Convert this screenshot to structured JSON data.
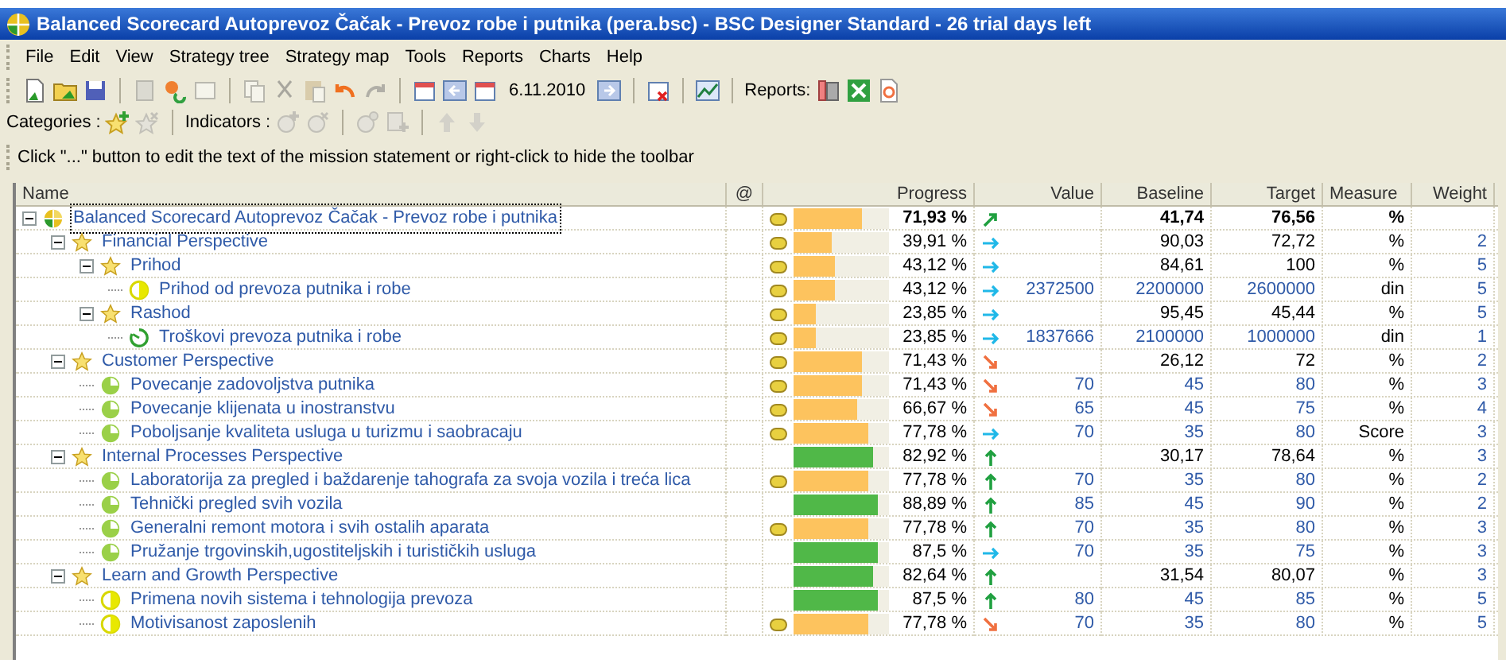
{
  "window": {
    "title": "Balanced Scorecard Autoprevoz Čačak - Prevoz robe i putnika (pera.bsc) - BSC Designer Standard - 26 trial days left"
  },
  "menu": [
    "File",
    "Edit",
    "View",
    "Strategy tree",
    "Strategy map",
    "Tools",
    "Reports",
    "Charts",
    "Help"
  ],
  "toolbar": {
    "date": "6.11.2010",
    "reports_label": "Reports:"
  },
  "category_toolbar": {
    "categories_label": "Categories :",
    "indicators_label": "Indicators :"
  },
  "mission_bar": {
    "text": "Click \"...\" button to edit the text of the mission statement or right-click to hide the toolbar"
  },
  "table": {
    "columns": [
      "Name",
      "@",
      "Progress",
      "Value",
      "Baseline",
      "Target",
      "Measure",
      "Weight"
    ],
    "rows": [
      {
        "name": "Balanced Scorecard Autoprevoz Čačak - Prevoz robe i putnika",
        "kind": "root",
        "expanded": true,
        "selected": true,
        "alert": true,
        "level": 0.7193,
        "progress": "71,93 %",
        "color": "#fdc35e",
        "trend": {
          "kind": "rising"
        },
        "baseline": "41,74",
        "target": "76,56",
        "measure": "%",
        "children": [
          {
            "name": "Financial Perspective",
            "kind": "category",
            "expanded": true,
            "selected": false,
            "alert": true,
            "level": 0.3991,
            "progress": "39,91 %",
            "color": "#fdc35e",
            "trend": {
              "kind": "flat"
            },
            "baseline": "90,03",
            "target": "72,72",
            "measure": "%",
            "weight": "2",
            "children": [
              {
                "name": "Prihod",
                "kind": "category",
                "expanded": true,
                "selected": false,
                "alert": true,
                "level": 0.4312,
                "progress": "43,12 %",
                "color": "#fdc35e",
                "trend": {
                  "kind": "flat"
                },
                "baseline": "84,61",
                "target": "100",
                "measure": "%",
                "weight": "5",
                "children": [
                  {
                    "name": "Prihod od prevoza putnika i robe",
                    "kind": "half",
                    "selected": false,
                    "alert": true,
                    "level": 0.4312,
                    "progress": "43,12 %",
                    "color": "#fdc35e",
                    "trend": {
                      "kind": "flat"
                    },
                    "value": "2372500",
                    "baseline": "2200000",
                    "target": "2600000",
                    "measure": "din",
                    "weight": "5"
                  }
                ]
              },
              {
                "name": "Rashod",
                "kind": "category",
                "expanded": true,
                "selected": false,
                "alert": true,
                "level": 0.2385,
                "progress": "23,85 %",
                "color": "#fdc35e",
                "trend": {
                  "kind": "flat"
                },
                "baseline": "95,45",
                "target": "45,44",
                "measure": "%",
                "weight": "5",
                "children": [
                  {
                    "name": "Troškovi prevoza putnika i robe",
                    "kind": "ring",
                    "selected": false,
                    "alert": true,
                    "level": 0.2385,
                    "progress": "23,85 %",
                    "color": "#fdc35e",
                    "trend": {
                      "kind": "flat"
                    },
                    "value": "1837666",
                    "baseline": "2100000",
                    "target": "1000000",
                    "measure": "din",
                    "weight": "1"
                  }
                ]
              }
            ]
          },
          {
            "name": "Customer Perspective",
            "kind": "category",
            "expanded": true,
            "selected": false,
            "alert": true,
            "level": 0.7143,
            "progress": "71,43 %",
            "color": "#fdc35e",
            "trend": {
              "kind": "falling"
            },
            "baseline": "26,12",
            "target": "72",
            "measure": "%",
            "weight": "2",
            "children": [
              {
                "name": "Povecanje zadovoljstva putnika",
                "kind": "pie",
                "selected": false,
                "alert": true,
                "level": 0.7143,
                "progress": "71,43 %",
                "color": "#fdc35e",
                "trend": {
                  "kind": "falling"
                },
                "value": "70",
                "baseline": "45",
                "target": "80",
                "measure": "%",
                "weight": "3"
              },
              {
                "name": "Povecanje klijenata u inostranstvu",
                "kind": "pie",
                "selected": false,
                "alert": true,
                "level": 0.6667,
                "progress": "66,67 %",
                "color": "#fdc35e",
                "trend": {
                  "kind": "falling"
                },
                "value": "65",
                "baseline": "45",
                "target": "75",
                "measure": "%",
                "weight": "4"
              },
              {
                "name": "Poboljsanje kvaliteta usluga u turizmu i saobracaju",
                "kind": "pie",
                "selected": false,
                "alert": true,
                "level": 0.7778,
                "progress": "77,78 %",
                "color": "#fdc35e",
                "trend": {
                  "kind": "flat"
                },
                "value": "70",
                "baseline": "35",
                "target": "80",
                "measure": "Score",
                "weight": "3"
              }
            ]
          },
          {
            "name": "Internal Processes Perspective",
            "kind": "category",
            "expanded": true,
            "selected": false,
            "alert": false,
            "level": 0.8292,
            "progress": "82,92 %",
            "color": "#50b848",
            "trend": {
              "kind": "up"
            },
            "baseline": "30,17",
            "target": "78,64",
            "measure": "%",
            "weight": "3",
            "children": [
              {
                "name": "Laboratorija za pregled i baždarenje tahografa za svoja vozila i treća lica",
                "kind": "pie",
                "selected": false,
                "alert": true,
                "level": 0.7778,
                "progress": "77,78 %",
                "color": "#fdc35e",
                "trend": {
                  "kind": "up"
                },
                "value": "70",
                "baseline": "35",
                "target": "80",
                "measure": "%",
                "weight": "2"
              },
              {
                "name": "Tehnički pregled svih vozila",
                "kind": "pie",
                "selected": false,
                "alert": false,
                "level": 0.8889,
                "progress": "88,89 %",
                "color": "#50b848",
                "trend": {
                  "kind": "up"
                },
                "value": "85",
                "baseline": "45",
                "target": "90",
                "measure": "%",
                "weight": "2"
              },
              {
                "name": "Generalni remont motora i svih ostalih aparata",
                "kind": "pie",
                "selected": false,
                "alert": true,
                "level": 0.7778,
                "progress": "77,78 %",
                "color": "#fdc35e",
                "trend": {
                  "kind": "up"
                },
                "value": "70",
                "baseline": "35",
                "target": "80",
                "measure": "%",
                "weight": "3"
              },
              {
                "name": "Pružanje trgovinskih,ugostiteljskih i turističkih usluga",
                "kind": "pie",
                "selected": false,
                "alert": false,
                "level": 0.875,
                "progress": "87,5 %",
                "color": "#50b848",
                "trend": {
                  "kind": "flat"
                },
                "value": "70",
                "baseline": "35",
                "target": "75",
                "measure": "%",
                "weight": "3"
              }
            ]
          },
          {
            "name": "Learn and Growth Perspective",
            "kind": "category",
            "expanded": true,
            "selected": false,
            "alert": false,
            "level": 0.8264,
            "progress": "82,64 %",
            "color": "#50b848",
            "trend": {
              "kind": "up"
            },
            "baseline": "31,54",
            "target": "80,07",
            "measure": "%",
            "weight": "3",
            "children": [
              {
                "name": "Primena novih sistema i tehnologija prevoza",
                "kind": "half",
                "selected": false,
                "alert": false,
                "level": 0.875,
                "progress": "87,5 %",
                "color": "#50b848",
                "trend": {
                  "kind": "up"
                },
                "value": "80",
                "baseline": "45",
                "target": "85",
                "measure": "%",
                "weight": "5"
              },
              {
                "name": "Motivisanost zaposlenih",
                "kind": "half",
                "selected": false,
                "alert": true,
                "level": 0.7778,
                "progress": "77,78 %",
                "color": "#fdc35e",
                "trend": {
                  "kind": "falling"
                },
                "value": "70",
                "baseline": "35",
                "target": "80",
                "measure": "%",
                "weight": "5"
              }
            ]
          }
        ]
      }
    ]
  }
}
